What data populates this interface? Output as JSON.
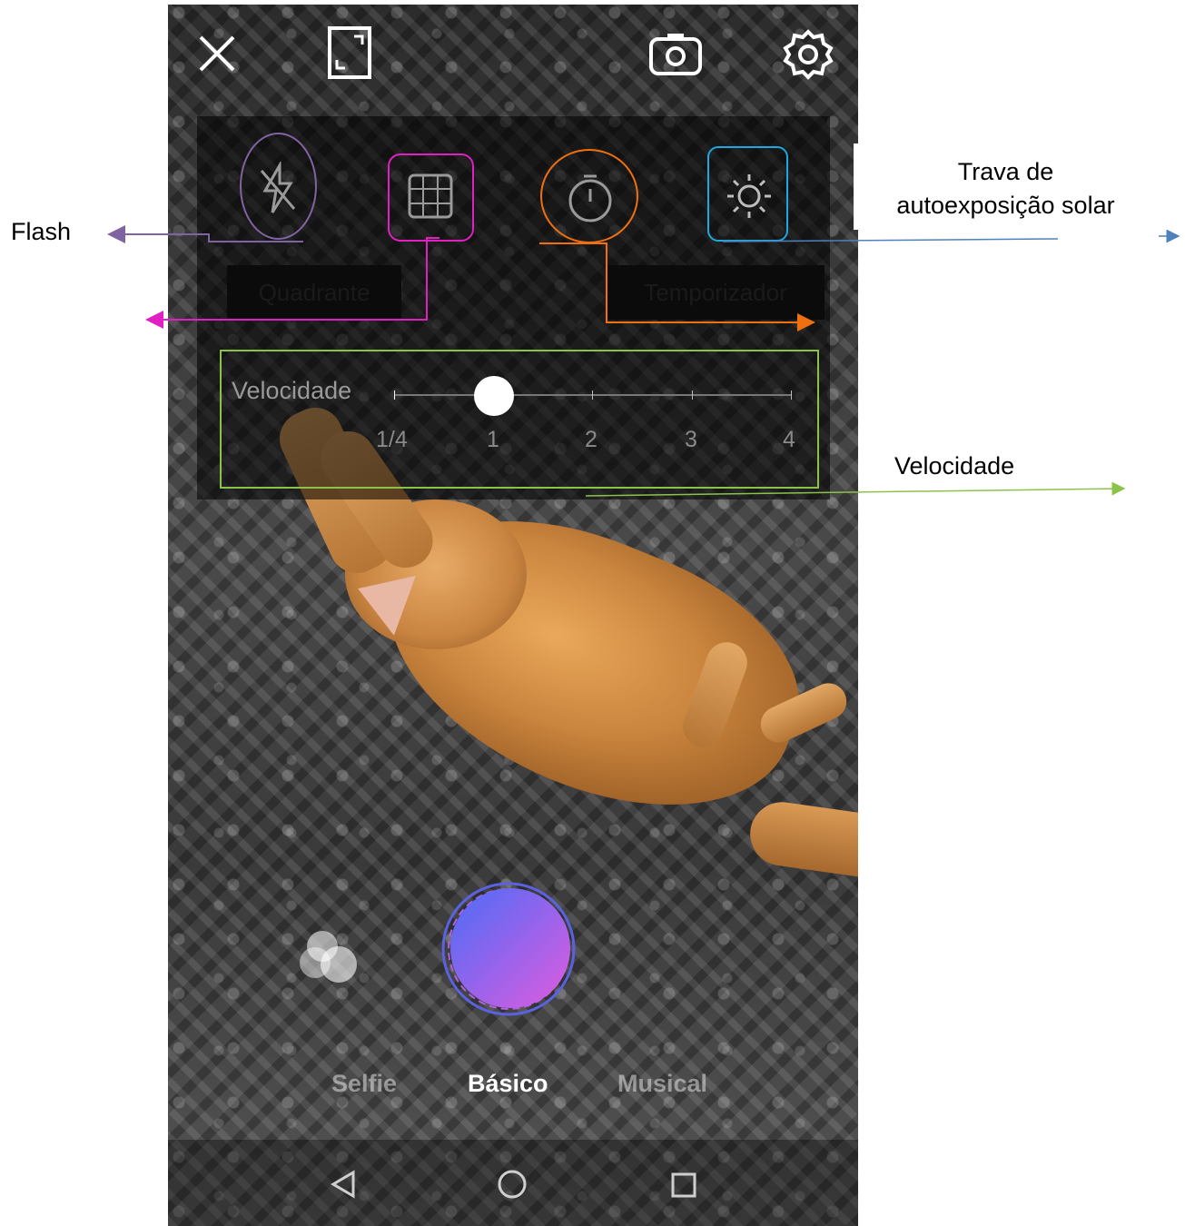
{
  "annotations": {
    "flash": "Flash",
    "quadrante": "Quadrante",
    "temporizador": "Temporizador",
    "trava_line1": "Trava de",
    "trava_line2": "autoexposição solar",
    "velocidade": "Velocidade"
  },
  "speed": {
    "label": "Velocidade",
    "ticks": [
      "1/4",
      "1",
      "2",
      "3",
      "4"
    ],
    "selected": "1"
  },
  "modes": [
    "Selfie",
    "Básico",
    "Musical"
  ],
  "selected_mode": "Básico",
  "icons": {
    "close": "close-icon",
    "aspect": "aspect-ratio-icon",
    "flip": "switch-camera-icon",
    "settings": "gear-icon",
    "flash": "flash-off-icon",
    "grid": "grid-icon",
    "timer": "timer-icon",
    "exposure": "sun-icon",
    "effects": "effects-bubbles-icon",
    "back": "nav-back-icon",
    "home": "nav-home-icon",
    "recents": "nav-recents-icon"
  },
  "colors": {
    "flash_highlight": "#8064A2",
    "grid_highlight": "#E020C0",
    "timer_highlight": "#F07010",
    "exposure_highlight": "#1CA8E0",
    "speed_highlight": "#8BC34A",
    "arrow_blue": "#4F81BD"
  }
}
